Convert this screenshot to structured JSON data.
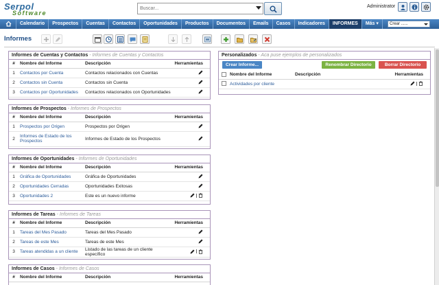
{
  "header": {
    "logo_line1": "Serpol",
    "logo_line2": "Software",
    "search_placeholder": "Buscar...",
    "user": "Administrator"
  },
  "nav": {
    "items": [
      "Calendario",
      "Prospectos",
      "Cuentas",
      "Contactos",
      "Oportunidades",
      "Productos",
      "Documentos",
      "Emails",
      "Casos",
      "Indicadores",
      "INFORMES",
      "Más"
    ],
    "active": "INFORMES",
    "create_label": "Crear ......"
  },
  "page": {
    "title": "Informes"
  },
  "columns": {
    "num": "#",
    "name": "Nombre del Informe",
    "desc": "Descripción",
    "tools": "Herramientas"
  },
  "panels": {
    "cuentas": {
      "title": "Informes de Cuentas y Contactos",
      "subtitle": " - Informes de Cuentas y Contactos",
      "rows": [
        {
          "num": "1",
          "name": "Contactos por Cuenta",
          "desc": "Contactos relacionados con Cuentas"
        },
        {
          "num": "2",
          "name": "Contactos sin Cuenta",
          "desc": "Contactos sin Cuenta"
        },
        {
          "num": "3",
          "name": "Contactos por Oportunidades",
          "desc": "Contactos relacionados con Oportunidades"
        }
      ]
    },
    "prospectos": {
      "title": "Informes de Prospectos",
      "subtitle": " - Informes de Prospectos",
      "rows": [
        {
          "num": "1",
          "name": "Prospectos por Origen",
          "desc": "Prospectos por Origen"
        },
        {
          "num": "2",
          "name": "Informes de Estado de los Prospectos",
          "desc": "Informes de Estado de los Prospectos"
        }
      ]
    },
    "oportunidades": {
      "title": "Informes de Oportunidades",
      "subtitle": " - Informes de Oportunidades",
      "rows": [
        {
          "num": "1",
          "name": "Gráfica de Oportunidades",
          "desc": "Gráfica de Oportunidades"
        },
        {
          "num": "2",
          "name": "Oportunidades Cerradas",
          "desc": "Oportunidades Exitosas"
        },
        {
          "num": "3",
          "name": "Oportunidades 2",
          "desc": "Este es un nuevo informe"
        }
      ]
    },
    "tareas": {
      "title": "Informes de Tareas",
      "subtitle": " - Informes de Tareas",
      "rows": [
        {
          "num": "1",
          "name": "Tareas del Mes Pasado",
          "desc": "Tareas del Mes Pasado"
        },
        {
          "num": "2",
          "name": "Tareas de este Mes",
          "desc": "Tareas de este Mes"
        },
        {
          "num": "3",
          "name": "Tareas atendidas a un cliente",
          "desc": "Listado de las tareas de un cliente específico"
        }
      ]
    },
    "casos": {
      "title": "Informes de Casos",
      "subtitle": " - Informes de Casos"
    },
    "personalizados": {
      "title": "Personalizados",
      "subtitle": " - Aca puse ejemplos de personalizados",
      "btn_create": "Crear Informe...",
      "btn_rename": "Renombrar Directorio",
      "btn_delete": "Borrar Directorio",
      "rows": [
        {
          "name": "Actividades por cliente"
        }
      ]
    }
  },
  "colors": {
    "nav": "#2d5f97",
    "active_tab": "#1d3f6a",
    "link": "#2b5b9a",
    "panel_border": "#a893b8",
    "btn_create": "#4a86c5",
    "btn_rename": "#7cb342",
    "btn_delete": "#d9534f"
  }
}
